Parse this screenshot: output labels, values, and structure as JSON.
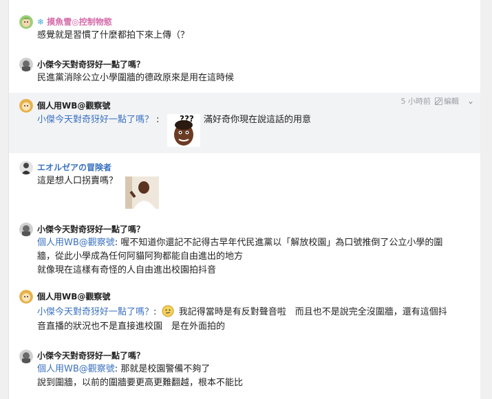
{
  "messages": [
    {
      "name": "摸魚雪◎控制物慾",
      "name_prefix": "❄",
      "lines": [
        "感覺就是習慣了什麼都拍下來上傳（？"
      ]
    },
    {
      "name": "小傑今天對奇犽好一點了嗎？",
      "lines": [
        "民進黨消除公立小學圍牆的德政原來是用在這時候"
      ]
    },
    {
      "name": "個人用WB@觀察號",
      "time": "5 小時前",
      "edit": "編輯",
      "mention": "小傑今天對奇犽好一點了嗎？",
      "sep": ":",
      "sticker_text": "???",
      "after": "滿好奇你現在說這話的用意"
    },
    {
      "name": "エオルゼアの冒険者",
      "lines": [
        "這是想人口拐賣嗎？"
      ]
    },
    {
      "name": "小傑今天對奇犽好一點了嗎？",
      "mention": "個人用WB@觀察號",
      "sep": ":",
      "line1_after": "喔不知道你還記不記得古早年代民進黨以「解放校園」為口號推倒了公立小學的圍",
      "line2": "牆，從此小學成為任何阿貓阿狗都能自由進出的地方",
      "line3": "就像現在這樣有奇怪的人自由進出校園拍抖音"
    },
    {
      "name": "個人用WB@觀察號",
      "mention": "小傑今天對奇犽好一點了嗎？",
      "sep": ":",
      "line1_after": "我記得當時是有反對聲音啦　而且也不是說完全沒圍牆，還有這個抖",
      "line2": "音直播的狀況也不是直接進校園　是在外面拍的"
    },
    {
      "name": "小傑今天對奇犽好一點了嗎？",
      "mention": "個人用WB@觀察號",
      "sep": ":",
      "line1_after": "那就是校園警備不夠了",
      "line2": "說到圍牆，以前的圍牆要更高更難翻越，根本不能比"
    }
  ]
}
